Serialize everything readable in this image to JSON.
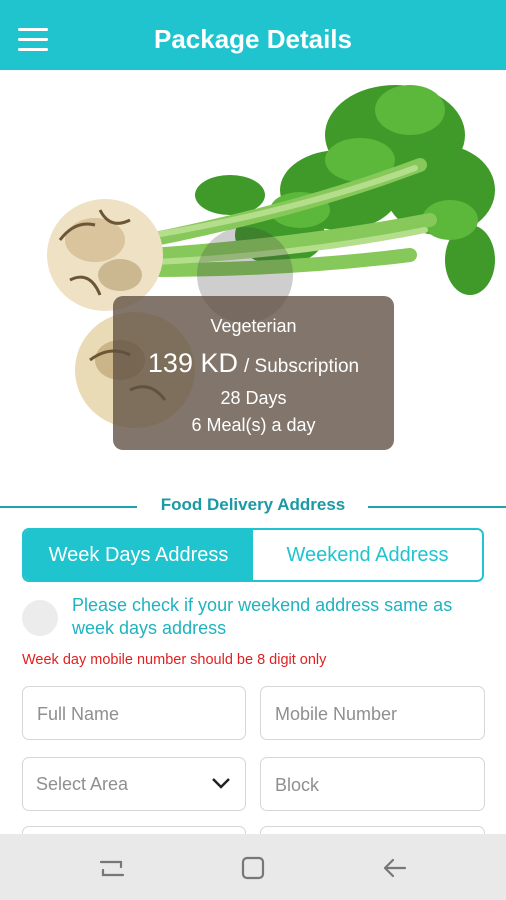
{
  "header": {
    "title": "Package Details",
    "menu_icon": "hamburger-menu-icon"
  },
  "package": {
    "plan": "Vegeterian",
    "price": "139 KD",
    "price_unit": "/ Subscription",
    "duration": "28 Days",
    "meals": "6 Meal(s) a day"
  },
  "address_section": {
    "title": "Food Delivery Address",
    "tabs": [
      {
        "label": "Week Days Address",
        "active": true
      },
      {
        "label": "Weekend Address",
        "active": false
      }
    ],
    "same_address_checkbox_label": "Please check if your weekend address same as week days address",
    "error_message": "Week day mobile number should be 8 digit only"
  },
  "form": {
    "full_name_placeholder": "Full Name",
    "mobile_placeholder": "Mobile Number",
    "area_select_value": "Select Area",
    "block_placeholder": "Block"
  },
  "nav": {
    "recents_icon": "recent-apps-icon",
    "home_icon": "home-icon",
    "back_icon": "back-arrow-icon"
  },
  "colors": {
    "accent": "#1fc4cf",
    "error": "#e02020",
    "card_overlay": "#5f5042"
  }
}
